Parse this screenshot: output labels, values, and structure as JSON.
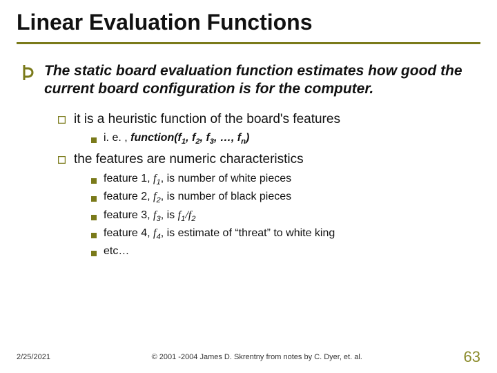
{
  "title": "Linear Evaluation Functions",
  "main_point": "The static board evaluation function estimates how good the current board configuration is for the computer.",
  "sub1": {
    "text": "it is a heuristic function of the board's features",
    "items": [
      {
        "prefix": "i. e. , ",
        "fn": "function(f",
        "s1": "1",
        "mid1": ", f",
        "s2": "2",
        "mid2": ", f",
        "s3": "3",
        "mid3": ", …, f",
        "sn": "n",
        "end": ")"
      }
    ]
  },
  "sub2": {
    "text": "the features are numeric characteristics",
    "items": [
      {
        "pre": "feature 1, ",
        "var": "f",
        "sub": "1",
        "post": ", is number of white pieces"
      },
      {
        "pre": "feature 2, ",
        "var": "f",
        "sub": "2",
        "post": ", is number of black pieces"
      },
      {
        "pre": "feature 3, ",
        "var": "f",
        "sub": "3",
        "post": ", is ",
        "var2": "f",
        "sub2": "1",
        "slash": "/",
        "var3": "f",
        "sub3": "2"
      },
      {
        "pre": "feature 4, ",
        "var": "f",
        "sub": "4",
        "post": ", is estimate of “threat” to white king"
      },
      {
        "pre": "etc…"
      }
    ]
  },
  "footer": {
    "date": "2/25/2021",
    "copyright": "© 2001 -2004 James D. Skrentny from notes by C. Dyer, et. al.",
    "page": "63"
  },
  "icons": {
    "thorn": "Þ"
  }
}
